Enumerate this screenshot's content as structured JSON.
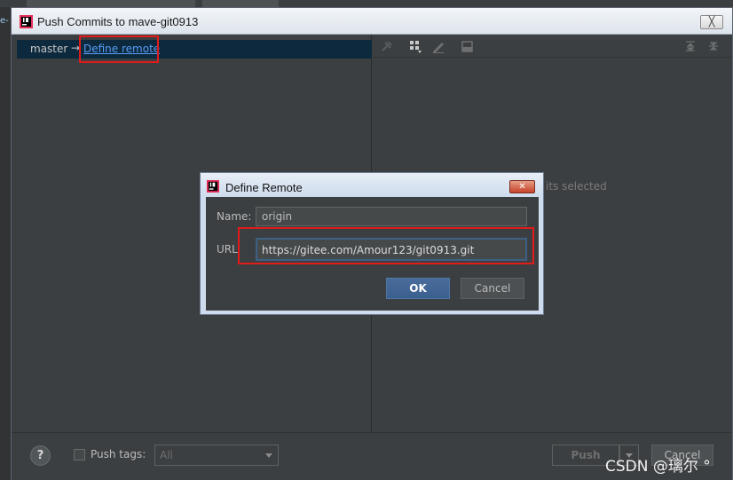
{
  "window": {
    "title": "Push Commits to mave-git0913",
    "close_symbol": "╳"
  },
  "background": {
    "left_fragment": "e-"
  },
  "left_pane": {
    "branch": "master",
    "arrow": "→",
    "remote_link": "Define remote"
  },
  "right_pane": {
    "empty_text": "its selected",
    "toolbar_icons": [
      "pin-icon",
      "group-icon",
      "edit-icon",
      "preview-icon",
      "expand-icon",
      "collapse-icon"
    ]
  },
  "bottom": {
    "help_symbol": "?",
    "push_tags_label": "Push tags:",
    "push_tags_checked": false,
    "tags_combo_value": "All",
    "push_label": "Push",
    "cancel_label": "Cancel"
  },
  "modal": {
    "title": "Define Remote",
    "close_symbol": "✕",
    "name_label": "Name:",
    "name_value": "origin",
    "url_label": "URL",
    "url_value": "https://gitee.com/Amour123/git0913.git",
    "ok_label": "OK",
    "cancel_label": "Cancel"
  },
  "watermark": "CSDN @璃尔 °",
  "colors": {
    "accent_highlight": "#e01b1b",
    "link": "#589df6",
    "selection": "#0d293e"
  }
}
